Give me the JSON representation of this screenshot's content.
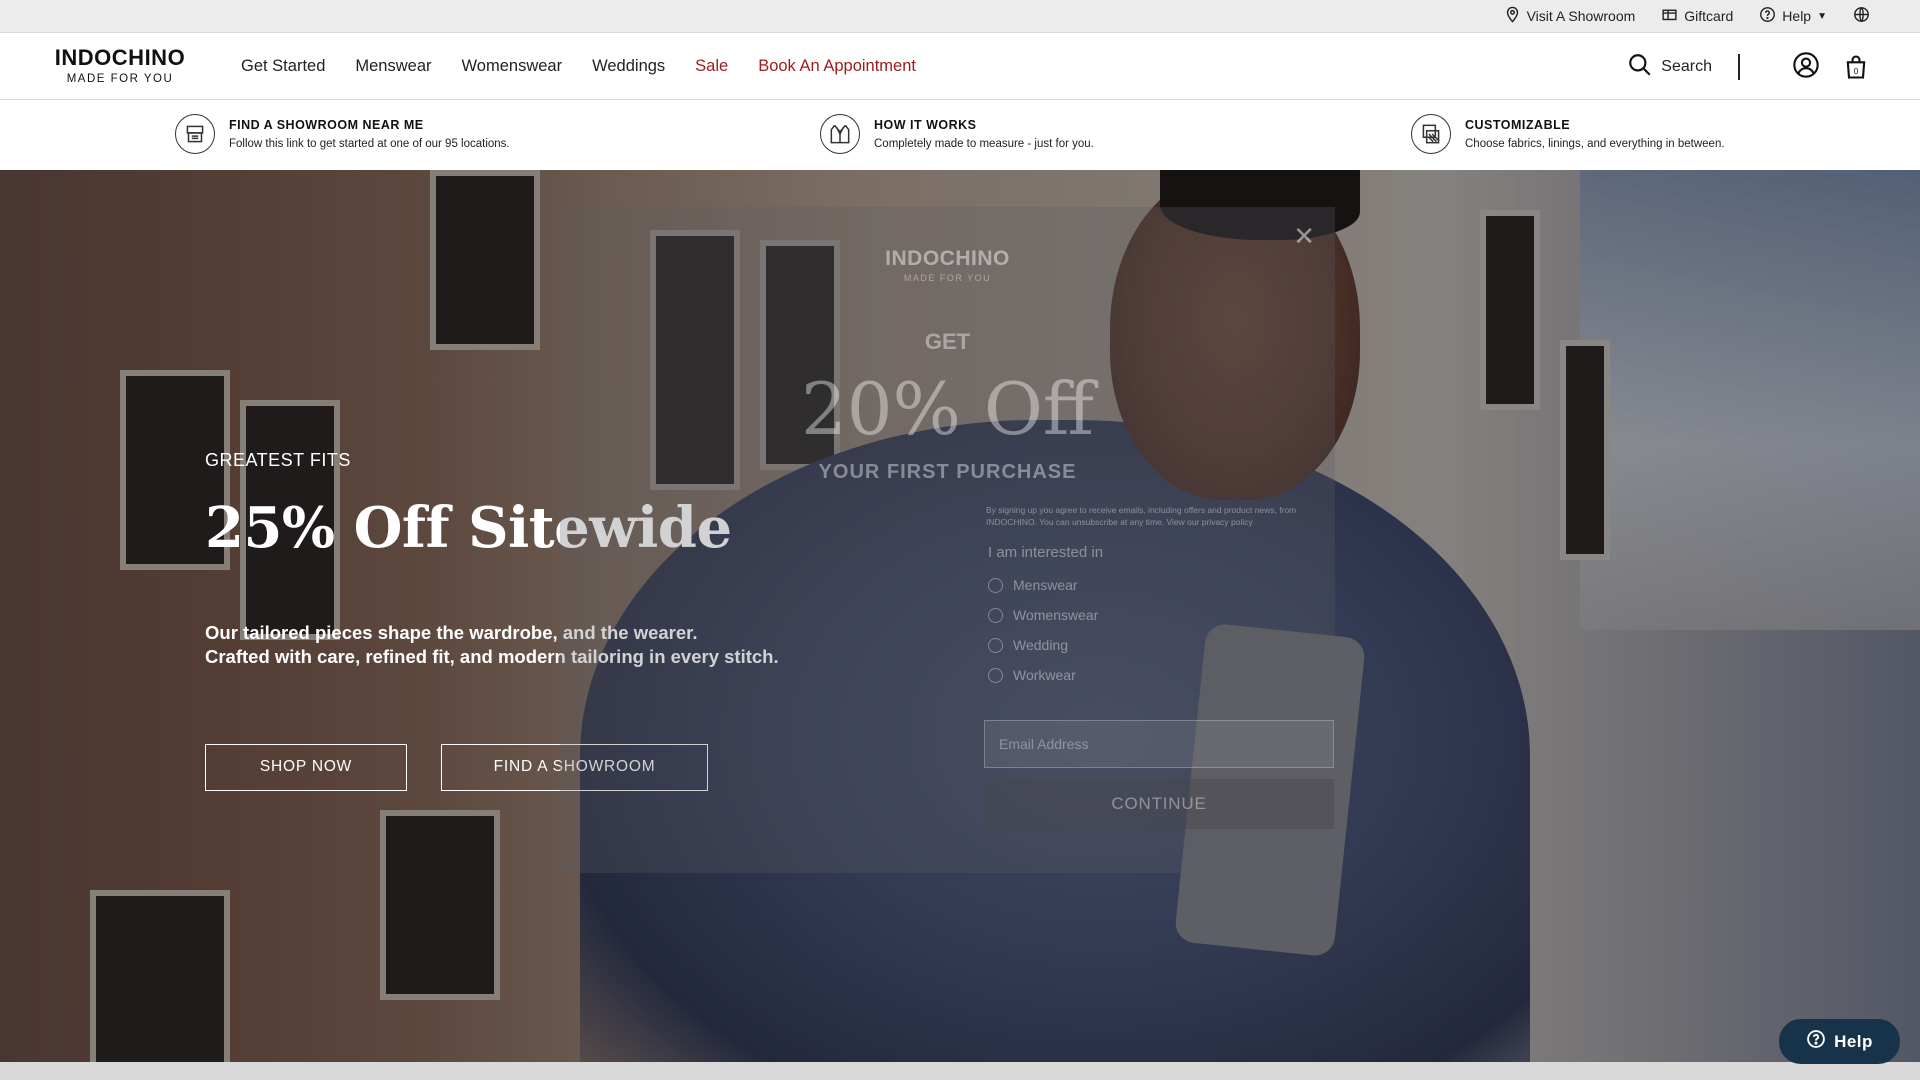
{
  "utility": {
    "visit_showroom": "Visit A Showroom",
    "giftcard": "Giftcard",
    "help": "Help"
  },
  "brand": {
    "name": "INDOCHINO",
    "tagline": "MADE FOR YOU"
  },
  "nav": {
    "links": [
      "Get Started",
      "Menswear",
      "Womenswear",
      "Weddings",
      "Sale",
      "Book An Appointment"
    ],
    "search_label": "Search",
    "cart_count": "0",
    "accent_color": "#9b1b1b"
  },
  "benefits": [
    {
      "title": "FIND A SHOWROOM NEAR ME",
      "desc": "Follow this link to get started at one of our 95 locations.",
      "icon": "store-icon"
    },
    {
      "title": "HOW IT WORKS",
      "desc": "Completely made to measure - just for you.",
      "icon": "suit-icon"
    },
    {
      "title": "CUSTOMIZABLE",
      "desc": "Choose fabrics, linings, and everything in between.",
      "icon": "fabric-swatch-icon"
    }
  ],
  "hero": {
    "eyebrow": "GREATEST FITS",
    "title": "25% Off Sitewide",
    "subtitle_line1": "Our tailored pieces shape the wardrobe, and the wearer.",
    "subtitle_line2": "Crafted with care, refined fit, and modern tailoring in every stitch.",
    "cta_shop": "SHOP NOW",
    "cta_showroom": "FIND A SHOWROOM"
  },
  "modal": {
    "close": "✕",
    "brand_name": "INDOCHINO",
    "brand_tagline": "MADE FOR YOU",
    "get": "GET",
    "offer": "20% Off",
    "purchase": "YOUR FIRST PURCHASE",
    "fine_print": "By signing up you agree to receive emails, including offers and product news, from INDOCHINO. You can unsubscribe at any time. View our privacy policy",
    "interest_label": "I am interested in",
    "options": [
      "Menswear",
      "Womenswear",
      "Wedding",
      "Workwear"
    ],
    "email_placeholder": "Email Address",
    "continue": "CONTINUE"
  },
  "help_widget": {
    "label": "Help"
  }
}
